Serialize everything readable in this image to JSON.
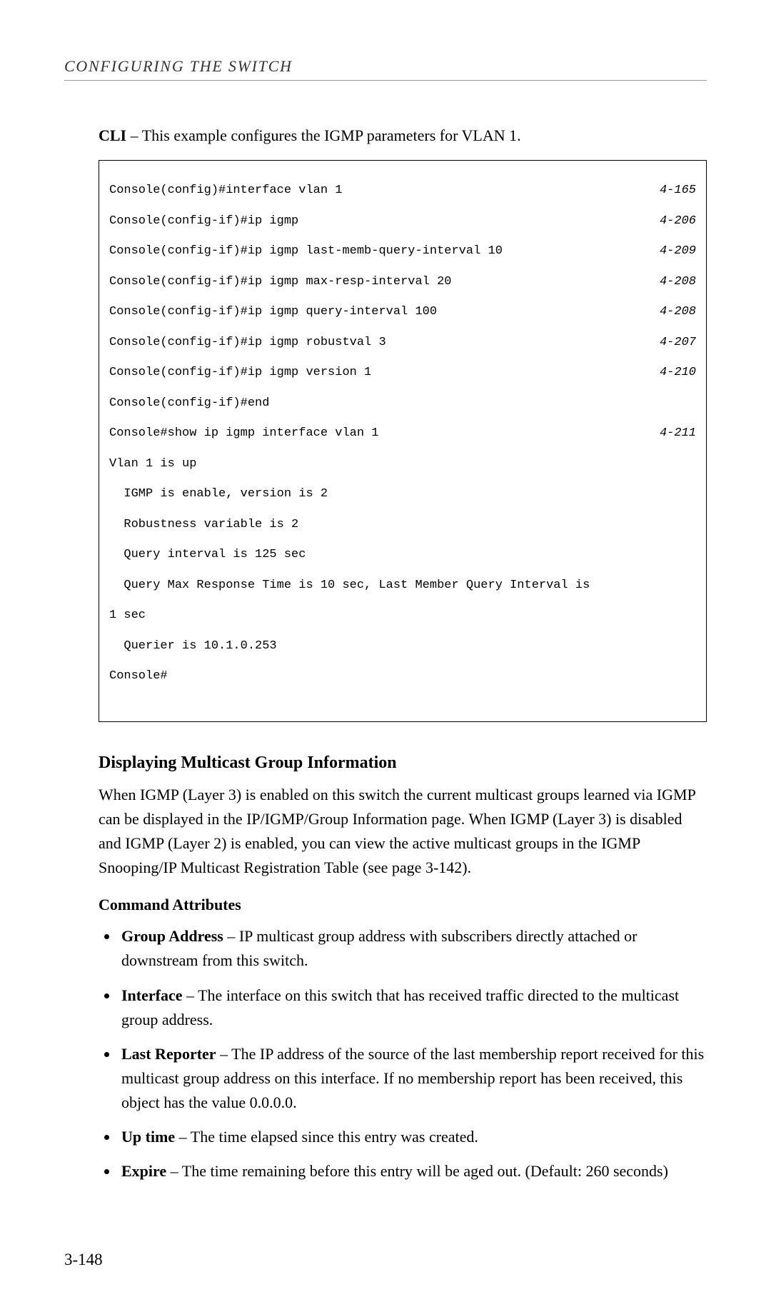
{
  "header": {
    "chapter": "CONFIGURING THE SWITCH"
  },
  "cli_intro": {
    "bold": "CLI",
    "rest": " – This example configures the IGMP parameters for VLAN 1."
  },
  "cli_box": {
    "lines": [
      {
        "cmd": "Console(config)#interface vlan 1",
        "ref": "4-165"
      },
      {
        "cmd": "Console(config-if)#ip igmp",
        "ref": "4-206"
      },
      {
        "cmd": "Console(config-if)#ip igmp last-memb-query-interval 10",
        "ref": "4-209"
      },
      {
        "cmd": "Console(config-if)#ip igmp max-resp-interval 20",
        "ref": "4-208"
      },
      {
        "cmd": "Console(config-if)#ip igmp query-interval 100",
        "ref": "4-208"
      },
      {
        "cmd": "Console(config-if)#ip igmp robustval 3",
        "ref": "4-207"
      },
      {
        "cmd": "Console(config-if)#ip igmp version 1",
        "ref": "4-210"
      },
      {
        "cmd": "Console(config-if)#end",
        "ref": ""
      },
      {
        "cmd": "Console#show ip igmp interface vlan 1",
        "ref": "4-211"
      },
      {
        "cmd": "Vlan 1 is up",
        "ref": ""
      },
      {
        "cmd": "  IGMP is enable, version is 2",
        "ref": ""
      },
      {
        "cmd": "  Robustness variable is 2",
        "ref": ""
      },
      {
        "cmd": "  Query interval is 125 sec",
        "ref": ""
      },
      {
        "cmd": "  Query Max Response Time is 10 sec, Last Member Query Interval is",
        "ref": ""
      },
      {
        "cmd": "1 sec",
        "ref": ""
      },
      {
        "cmd": "  Querier is 10.1.0.253",
        "ref": ""
      },
      {
        "cmd": "Console#",
        "ref": ""
      }
    ]
  },
  "section": {
    "heading": "Displaying Multicast Group Information",
    "para": "When IGMP (Layer 3) is enabled on this switch the current multicast groups learned via IGMP can be displayed in the IP/IGMP/Group Information page. When IGMP (Layer 3) is disabled and IGMP (Layer 2) is enabled, you can view the active multicast groups in the IGMP Snooping/IP Multicast Registration Table (see page 3-142)."
  },
  "command_attributes": {
    "heading": "Command Attributes",
    "items": [
      {
        "term": "Group Address",
        "desc": " – IP multicast group address with subscribers directly attached or downstream from this switch."
      },
      {
        "term": "Interface",
        "desc": " – The interface on this switch that has received traffic directed to the multicast group address."
      },
      {
        "term": "Last Reporter",
        "desc": " – The IP address of the source of the last membership report received for this multicast group address on this interface. If no membership report has been received, this object has the value 0.0.0.0."
      },
      {
        "term": "Up time",
        "desc": " – The time elapsed since this entry was created."
      },
      {
        "term": "Expire",
        "desc": " – The time remaining before this entry will be aged out. (Default: 260 seconds)"
      }
    ]
  },
  "footer": {
    "pagenum": "3-148"
  }
}
